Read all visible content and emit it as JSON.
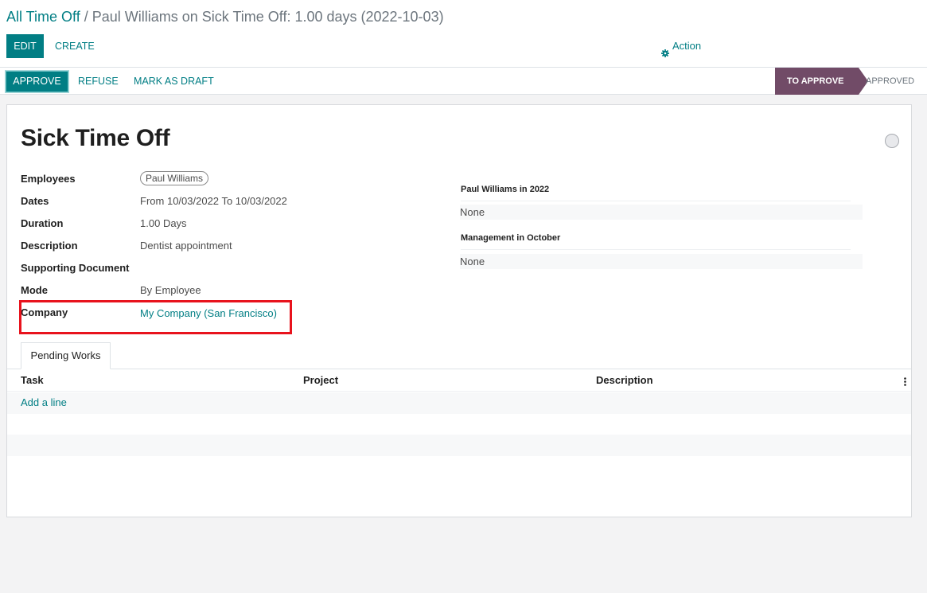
{
  "breadcrumb": {
    "root": "All Time Off",
    "separator": "/",
    "current": "Paul Williams on Sick Time Off: 1.00 days (2022-10-03)"
  },
  "toolbar": {
    "edit_label": "EDIT",
    "create_label": "CREATE",
    "action_label": "Action"
  },
  "statusbar": {
    "approve_label": "APPROVE",
    "refuse_label": "REFUSE",
    "draft_label": "MARK AS DRAFT",
    "stages": [
      {
        "label": "TO APPROVE",
        "active": true
      },
      {
        "label": "APPROVED",
        "active": false
      }
    ]
  },
  "form": {
    "title": "Sick Time Off",
    "fields": {
      "employees_label": "Employees",
      "employees_value": "Paul Williams",
      "dates_label": "Dates",
      "dates_from": "From",
      "dates_from_value": "10/03/2022",
      "dates_to": "To",
      "dates_to_value": "10/03/2022",
      "duration_label": "Duration",
      "duration_value": "1.00",
      "duration_unit": "Days",
      "description_label": "Description",
      "description_value": "Dentist appointment",
      "supporting_label": "Supporting Document",
      "mode_label": "Mode",
      "mode_value": "By Employee",
      "company_label": "Company",
      "company_value": "My Company (San Francisco)"
    },
    "side": {
      "employee_year_title": "Paul Williams in 2022",
      "employee_year_value": "None",
      "mgmt_title": "Management in October",
      "mgmt_value": "None"
    }
  },
  "tabs": {
    "pending_label": "Pending Works"
  },
  "table": {
    "columns": [
      "Task",
      "Project",
      "Description"
    ],
    "add_line_label": "Add a line"
  },
  "colors": {
    "accent": "#017e84",
    "stage_active": "#714b67",
    "highlight": "#e8131d"
  }
}
